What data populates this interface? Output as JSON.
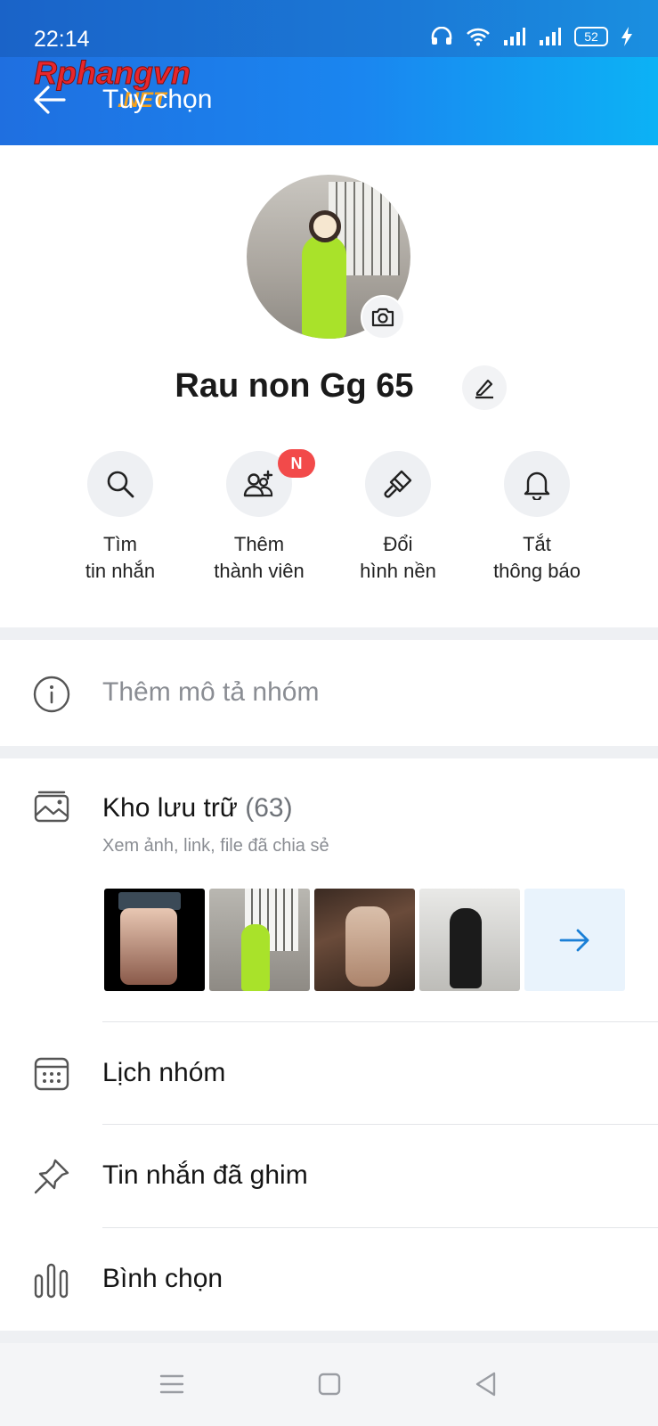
{
  "status_bar": {
    "time": "22:14",
    "battery": "52"
  },
  "header": {
    "title": "Tùy chọn",
    "watermark": "Rphangvn.NET"
  },
  "profile": {
    "name": "Rau non Gg 65"
  },
  "actions": [
    {
      "line1": "Tìm",
      "line2": "tin nhắn",
      "icon": "search-icon"
    },
    {
      "line1": "Thêm",
      "line2": "thành viên",
      "icon": "add-member-icon",
      "badge": "N"
    },
    {
      "line1": "Đổi",
      "line2": "hình nền",
      "icon": "paint-brush-icon"
    },
    {
      "line1": "Tắt",
      "line2": "thông báo",
      "icon": "bell-icon"
    }
  ],
  "description": {
    "placeholder": "Thêm mô tả nhóm"
  },
  "storage": {
    "title": "Kho lưu trữ",
    "count": "(63)",
    "subtitle": "Xem ảnh, link, file đã chia sẻ"
  },
  "menu": [
    {
      "label": "Lịch nhóm",
      "icon": "calendar-icon"
    },
    {
      "label": "Tin nhắn đã ghim",
      "icon": "pin-icon"
    },
    {
      "label": "Bình chọn",
      "icon": "poll-icon"
    }
  ],
  "colors": {
    "header_start": "#1f6fe0",
    "header_end": "#0cb2f5",
    "badge": "#f24a4a",
    "accent": "#1a7fd6"
  }
}
